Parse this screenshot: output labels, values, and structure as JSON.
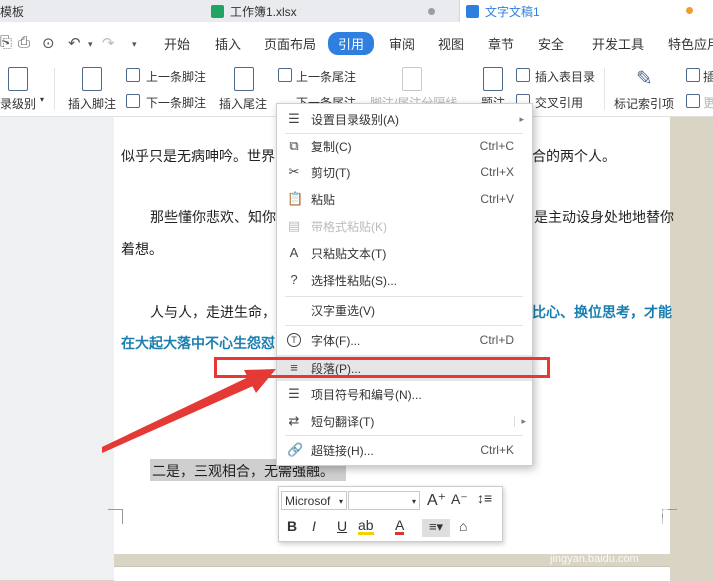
{
  "tabs": [
    {
      "label": "模板"
    },
    {
      "label": "工作簿1.xlsx"
    },
    {
      "label": "文字文稿1"
    }
  ],
  "menu": {
    "tabs": [
      "开始",
      "插入",
      "页面布局",
      "引用",
      "审阅",
      "视图",
      "章节",
      "安全",
      "开发工具",
      "特色应用"
    ],
    "active": "引用"
  },
  "ribbon": {
    "toc_level": "录级别",
    "insert_footnote": "插入脚注",
    "prev_footnote": "上一条脚注",
    "next_footnote": "下一条脚注",
    "insert_endnote": "插入尾注",
    "prev_endnote": "上一条尾注",
    "next_endnote": "下一条尾注",
    "footnote_sep": "脚注/尾注分隔线",
    "caption": "题注",
    "insert_toc_table": "插入表目录",
    "cross_ref": "交叉引用",
    "mark_index": "标记索引项",
    "insert_index": "插",
    "update_index": "更"
  },
  "document": {
    "line1": "似乎只是无病呻吟。世界",
    "line1_tail": "合的两个人。",
    "line2a": "那些懂你悲欢、知你",
    "line2a_tail": "是主动设身处地地替你",
    "line2b": "着想。",
    "line3a": "人与人，走进生命，",
    "line3a_tail": "比心、换位思考，才能",
    "line3b": "在大起大落中不心生怨怼",
    "line4": "二是，三观相合，无需强融。"
  },
  "context_menu": {
    "items": [
      {
        "label": "设置目录级别(A)",
        "shortcut": "",
        "submenu": true
      },
      {
        "label": "复制(C)",
        "shortcut": "Ctrl+C"
      },
      {
        "label": "剪切(T)",
        "shortcut": "Ctrl+X"
      },
      {
        "label": "粘贴",
        "shortcut": "Ctrl+V"
      },
      {
        "label": "带格式粘贴(K)",
        "shortcut": "",
        "disabled": true
      },
      {
        "label": "只粘贴文本(T)",
        "shortcut": ""
      },
      {
        "label": "选择性粘贴(S)...",
        "shortcut": ""
      },
      {
        "label": "汉字重选(V)",
        "shortcut": ""
      },
      {
        "label": "字体(F)...",
        "shortcut": "Ctrl+D"
      },
      {
        "label": "段落(P)...",
        "shortcut": "",
        "highlighted": true
      },
      {
        "label": "项目符号和编号(N)...",
        "shortcut": ""
      },
      {
        "label": "短句翻译(T)",
        "shortcut": "",
        "submenu": true
      },
      {
        "label": "超链接(H)...",
        "shortcut": "Ctrl+K"
      }
    ]
  },
  "mini_toolbar": {
    "font": "Microsof",
    "size": "",
    "buttons": [
      "B",
      "I",
      "U",
      "ab",
      "A"
    ]
  },
  "watermark": {
    "brand": "Bai 经验",
    "url": "jingyan.baidu.com"
  },
  "colors": {
    "accent": "#2f7fe0",
    "annotation_red": "#e53935",
    "doc_blue_text": "#1a7fb0"
  }
}
